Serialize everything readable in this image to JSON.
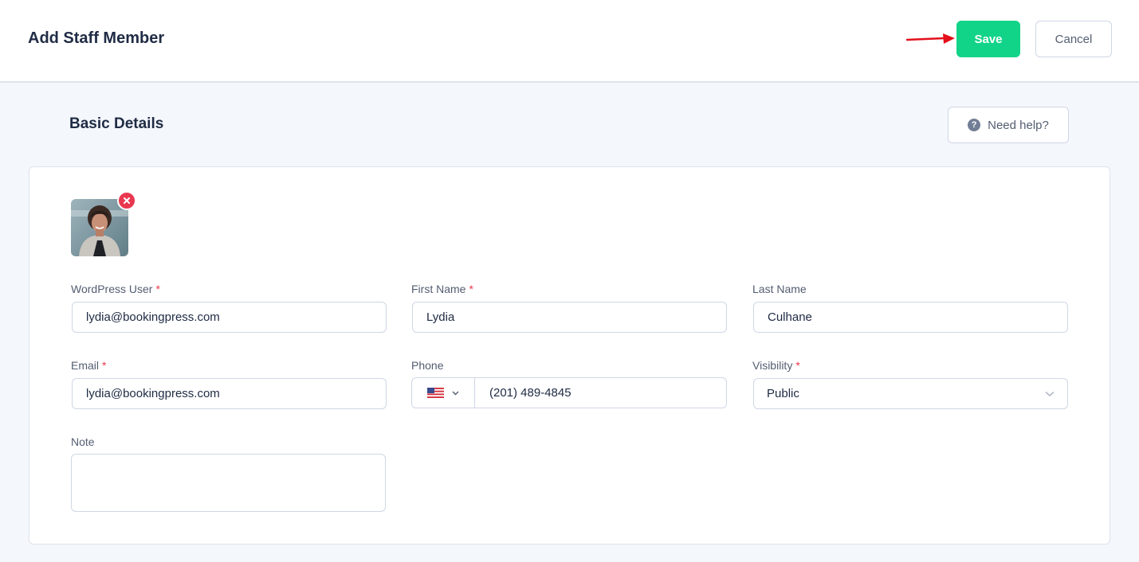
{
  "header": {
    "title": "Add Staff Member",
    "save_label": "Save",
    "cancel_label": "Cancel"
  },
  "section": {
    "title": "Basic Details",
    "help_label": "Need help?",
    "help_icon": "question-circle-icon"
  },
  "form": {
    "wordpress_user": {
      "label": "WordPress User",
      "required": "*",
      "value": "lydia@bookingpress.com"
    },
    "first_name": {
      "label": "First Name",
      "required": "*",
      "value": "Lydia"
    },
    "last_name": {
      "label": "Last Name",
      "value": "Culhane"
    },
    "email": {
      "label": "Email",
      "required": "*",
      "value": "lydia@bookingpress.com"
    },
    "phone": {
      "label": "Phone",
      "country_flag": "us-flag-icon",
      "value": "(201) 489-4845"
    },
    "visibility": {
      "label": "Visibility",
      "required": "*",
      "value": "Public"
    },
    "note": {
      "label": "Note",
      "value": ""
    }
  },
  "colors": {
    "accent": "#12d488",
    "danger": "#e9384f",
    "annotation_arrow": "#e3101b"
  }
}
